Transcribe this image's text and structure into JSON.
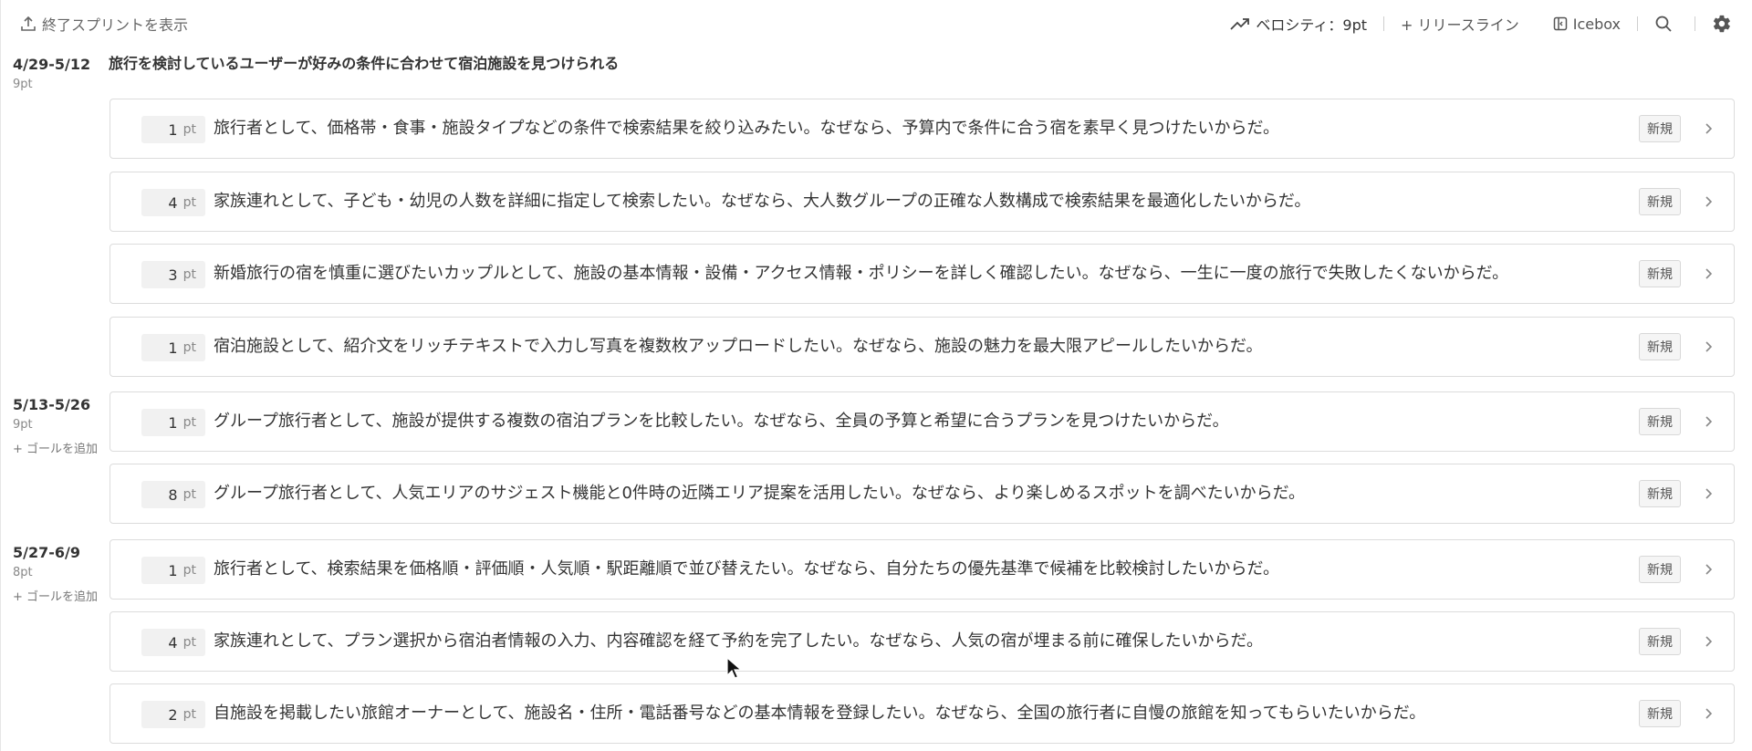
{
  "header": {
    "show_ended_label": "終了スプリントを表示",
    "velocity_label": "ベロシティ：9pt",
    "release_line_label": "+ リリースライン",
    "icebox_label": "Icebox"
  },
  "goal_title": "旅行を検討しているユーザーが好みの条件に合わせて宿泊施設を見つけられる",
  "sprints": [
    {
      "dates": "4/29-5/12",
      "points": "9pt"
    },
    {
      "dates": "5/13-5/26",
      "points": "9pt",
      "add_goal": "+ ゴールを追加"
    },
    {
      "dates": "5/27-6/9",
      "points": "8pt",
      "add_goal": "+ ゴールを追加"
    }
  ],
  "point_unit": "pt",
  "stories": [
    {
      "points": "1",
      "text": "旅行者として、価格帯・食事・施設タイプなどの条件で検索結果を絞り込みたい。なぜなら、予算内で条件に合う宿を素早く見つけたいからだ。",
      "status": "新規"
    },
    {
      "points": "4",
      "text": "家族連れとして、子ども・幼児の人数を詳細に指定して検索したい。なぜなら、大人数グループの正確な人数構成で検索結果を最適化したいからだ。",
      "status": "新規"
    },
    {
      "points": "3",
      "text": "新婚旅行の宿を慎重に選びたいカップルとして、施設の基本情報・設備・アクセス情報・ポリシーを詳しく確認したい。なぜなら、一生に一度の旅行で失敗したくないからだ。",
      "status": "新規"
    },
    {
      "points": "1",
      "text": "宿泊施設として、紹介文をリッチテキストで入力し写真を複数枚アップロードしたい。なぜなら、施設の魅力を最大限アピールしたいからだ。",
      "status": "新規"
    },
    {
      "points": "1",
      "text": "グループ旅行者として、施設が提供する複数の宿泊プランを比較したい。なぜなら、全員の予算と希望に合うプランを見つけたいからだ。",
      "status": "新規"
    },
    {
      "points": "8",
      "text": "グループ旅行者として、人気エリアのサジェスト機能と0件時の近隣エリア提案を活用したい。なぜなら、より楽しめるスポットを調べたいからだ。",
      "status": "新規"
    },
    {
      "points": "1",
      "text": "旅行者として、検索結果を価格順・評価順・人気順・駅距離順で並び替えたい。なぜなら、自分たちの優先基準で候補を比較検討したいからだ。",
      "status": "新規"
    },
    {
      "points": "4",
      "text": "家族連れとして、プラン選択から宿泊者情報の入力、内容確認を経て予約を完了したい。なぜなら、人気の宿が埋まる前に確保したいからだ。",
      "status": "新規"
    },
    {
      "points": "2",
      "text": "自施設を掲載したい旅館オーナーとして、施設名・住所・電話番号などの基本情報を登録したい。なぜなら、全国の旅行者に自慢の旅館を知ってもらいたいからだ。",
      "status": "新規"
    }
  ]
}
